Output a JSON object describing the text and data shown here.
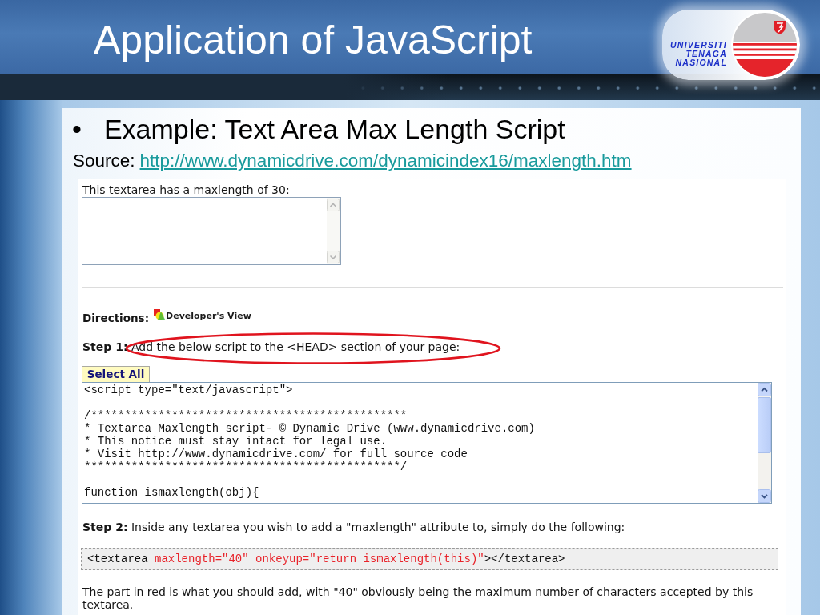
{
  "slide": {
    "title": "Application of JavaScript"
  },
  "logo": {
    "lines": [
      "UNIVERSITI",
      "TENAGA",
      "NASIONAL"
    ]
  },
  "bullet": {
    "marker": "•",
    "text": "Example: Text Area Max Length Script"
  },
  "source": {
    "label": "Source:",
    "link": "http://www.dynamicdrive.com/dynamicindex16/maxlength.htm"
  },
  "web_page": {
    "demo_label": "This textarea has a maxlength of 30:",
    "directions": {
      "label": "Directions:",
      "link": "Developer's View"
    },
    "step1": {
      "text": "**Step 1:** Add the below script to the <HEAD> section of your page:",
      "circled": true
    },
    "select_all_button": "Select All",
    "code": "<script type=\"text/javascript\">\n\n/***********************************************\n* Textarea Maxlength script- © Dynamic Drive (www.dynamicdrive.com)\n* This notice must stay intact for legal use.\n* Visit http://www.dynamicdrive.com/ for full source code\n***********************************************/\n\nfunction ismaxlength(obj){",
    "step2": {
      "text": "**Step 2:** Inside any textarea you wish to add a \"maxlength\" attribute to, simply do the following:"
    },
    "snippet": [
      {
        "text": "<textarea ",
        "highlighted": false
      },
      {
        "text": "maxlength=\"40\" onkeyup=\"return ismaxlength(this)\"",
        "highlighted": true
      },
      {
        "text": "></textarea>",
        "highlighted": false
      }
    ],
    "note": "The part in red is what you should add, with \"40\" obviously being the maximum number of characters accepted by this textarea."
  }
}
